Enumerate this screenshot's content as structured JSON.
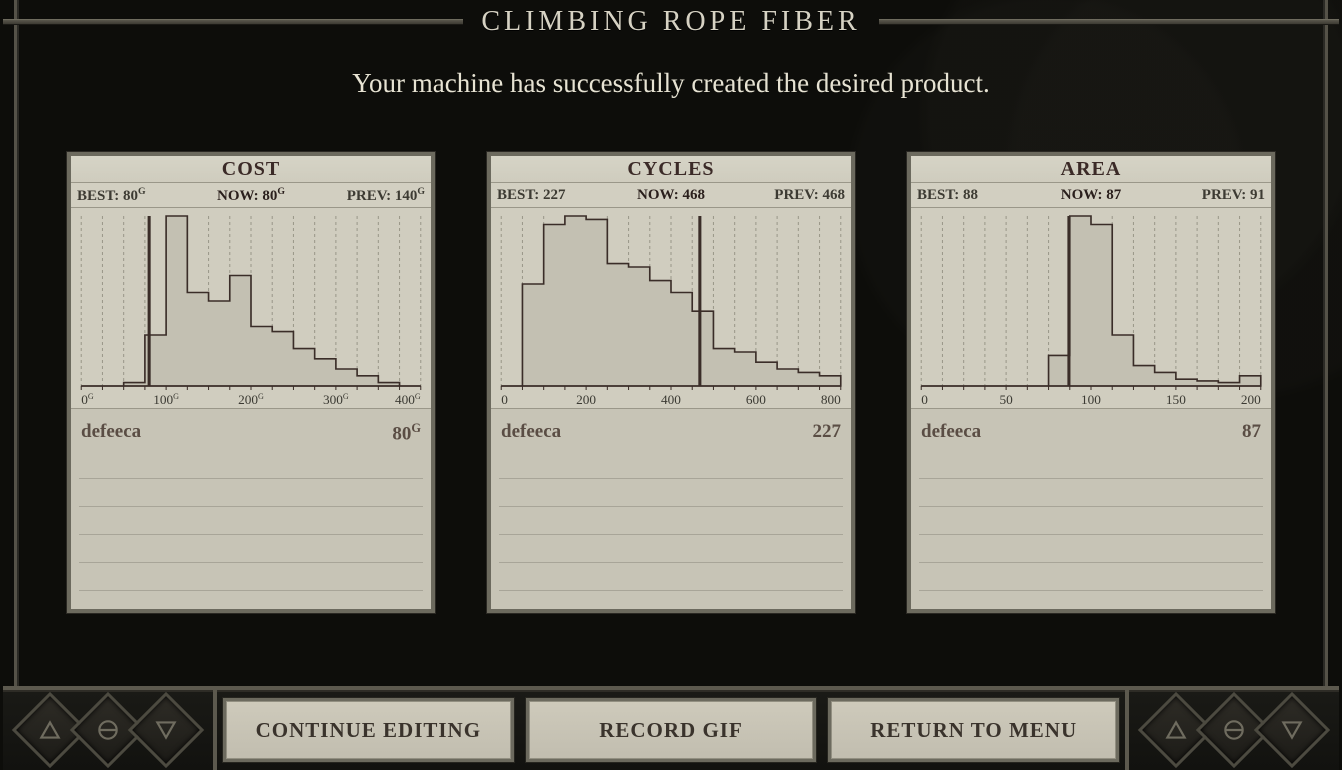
{
  "puzzle_title": "CLIMBING ROPE FIBER",
  "subtitle": "Your machine has successfully created the desired product.",
  "panels": {
    "cost": {
      "title": "COST",
      "best": "BEST: 80",
      "best_unit": "G",
      "now": "NOW: 80",
      "now_unit": "G",
      "prev": "PREV: 140",
      "prev_unit": "G"
    },
    "cycles": {
      "title": "CYCLES",
      "best": "BEST: 227",
      "best_unit": "",
      "now": "NOW: 468",
      "now_unit": "",
      "prev": "PREV: 468",
      "prev_unit": ""
    },
    "area": {
      "title": "AREA",
      "best": "BEST: 88",
      "best_unit": "",
      "now": "NOW: 87",
      "now_unit": "",
      "prev": "PREV: 91",
      "prev_unit": ""
    }
  },
  "chart_data": [
    {
      "id": "cost",
      "type": "bar",
      "title": "COST",
      "xlabel": "",
      "ylabel": "",
      "x_range": [
        0,
        400
      ],
      "x_ticks": [
        0,
        100,
        200,
        300,
        400
      ],
      "x_unit": "G",
      "marker": 80,
      "bins": [
        0,
        25,
        50,
        75,
        100,
        125,
        150,
        175,
        200,
        225,
        250,
        275,
        300,
        325,
        350,
        375,
        400
      ],
      "values": [
        0,
        0,
        2,
        30,
        100,
        55,
        50,
        65,
        35,
        32,
        22,
        16,
        10,
        6,
        2,
        0
      ]
    },
    {
      "id": "cycles",
      "type": "bar",
      "title": "CYCLES",
      "xlabel": "",
      "ylabel": "",
      "x_range": [
        0,
        800
      ],
      "x_ticks": [
        0,
        200,
        400,
        600,
        800
      ],
      "x_unit": "",
      "marker": 468,
      "bins": [
        0,
        50,
        100,
        150,
        200,
        250,
        300,
        350,
        400,
        450,
        500,
        550,
        600,
        650,
        700,
        750,
        800
      ],
      "values": [
        0,
        60,
        95,
        100,
        98,
        72,
        70,
        62,
        55,
        44,
        22,
        20,
        14,
        10,
        8,
        6
      ]
    },
    {
      "id": "area",
      "type": "bar",
      "title": "AREA",
      "xlabel": "",
      "ylabel": "",
      "x_range": [
        0,
        200
      ],
      "x_ticks": [
        0,
        50,
        100,
        150,
        200
      ],
      "x_unit": "",
      "marker": 87,
      "bins": [
        0,
        12.5,
        25,
        37.5,
        50,
        62.5,
        75,
        87.5,
        100,
        112.5,
        125,
        137.5,
        150,
        162.5,
        175,
        187.5,
        200
      ],
      "values": [
        0,
        0,
        0,
        0,
        0,
        0,
        18,
        100,
        95,
        30,
        12,
        8,
        4,
        3,
        2,
        6
      ]
    }
  ],
  "leaderboard": {
    "cost": {
      "name": "defeeca",
      "value": "80",
      "unit": "G"
    },
    "cycles": {
      "name": "defeeca",
      "value": "227",
      "unit": ""
    },
    "area": {
      "name": "defeeca",
      "value": "87",
      "unit": ""
    }
  },
  "buttons": {
    "continue": "CONTINUE EDITING",
    "record": "RECORD GIF",
    "menu": "RETURN TO MENU"
  }
}
